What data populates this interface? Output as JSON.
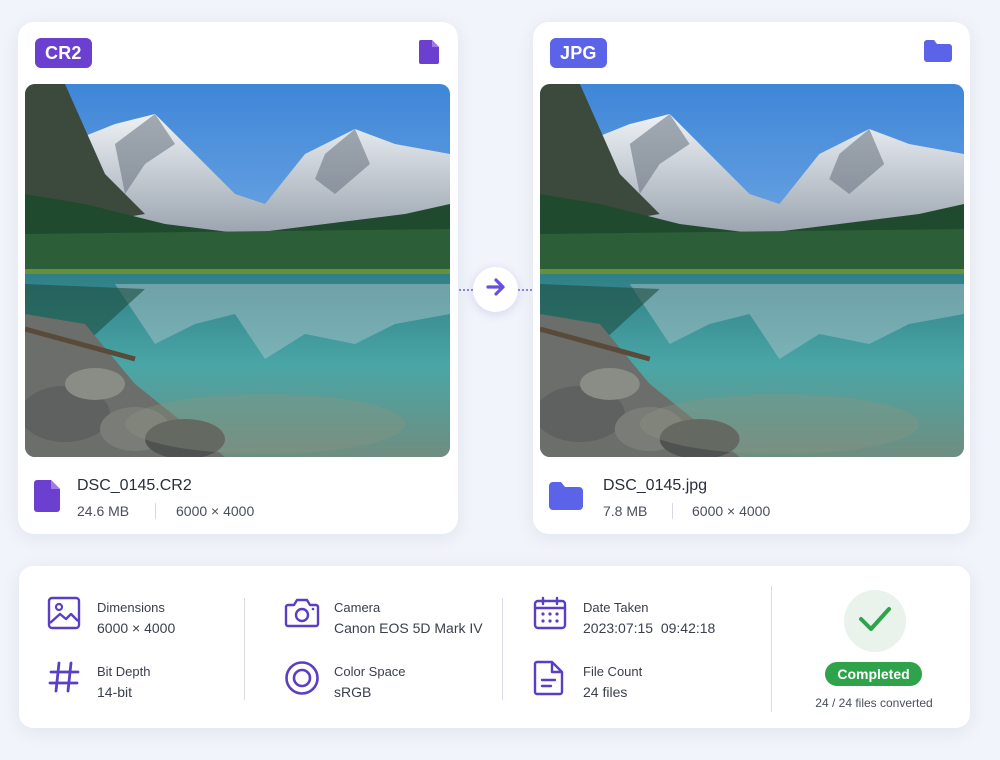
{
  "colors": {
    "source_accent": "#6b3fcf",
    "target_accent": "#5b63e8",
    "arrow": "#6a4ee0",
    "meta_icon": "#5a3fc4",
    "success": "#2fa34a"
  },
  "source": {
    "format": "CR2",
    "corner_icon": "file-icon",
    "file_icon": "file-icon",
    "filename": "DSC_0145.CR2",
    "size": "24.6 MB",
    "dimensions": "6000 × 4000"
  },
  "convert": {
    "icon": "arrow-right-icon"
  },
  "target": {
    "format": "JPG",
    "corner_icon": "folder-icon",
    "file_icon": "folder-icon",
    "filename": "DSC_0145.jpg",
    "size": "7.8 MB",
    "dimensions": "6000 × 4000"
  },
  "metadata": {
    "dimensions": {
      "icon": "image-icon",
      "label": "Dimensions",
      "value": "6000 × 4000"
    },
    "bit_depth": {
      "icon": "hash-icon",
      "label": "Bit Depth",
      "value": "14-bit"
    },
    "camera": {
      "icon": "camera-icon",
      "label": "Camera",
      "value": "Canon EOS 5D Mark IV"
    },
    "color_space": {
      "icon": "color-space-icon",
      "label": "Color Space",
      "value": "sRGB"
    },
    "date_taken": {
      "icon": "calendar-icon",
      "label": "Date Taken",
      "value": "2023:07:15  09:42:18"
    },
    "file_count": {
      "icon": "document-icon",
      "label": "File Count",
      "value": "24 files"
    }
  },
  "status": {
    "icon": "check-icon",
    "label": "Completed",
    "progress_text": "24 / 24 files converted",
    "converted": 24,
    "total": 24
  }
}
